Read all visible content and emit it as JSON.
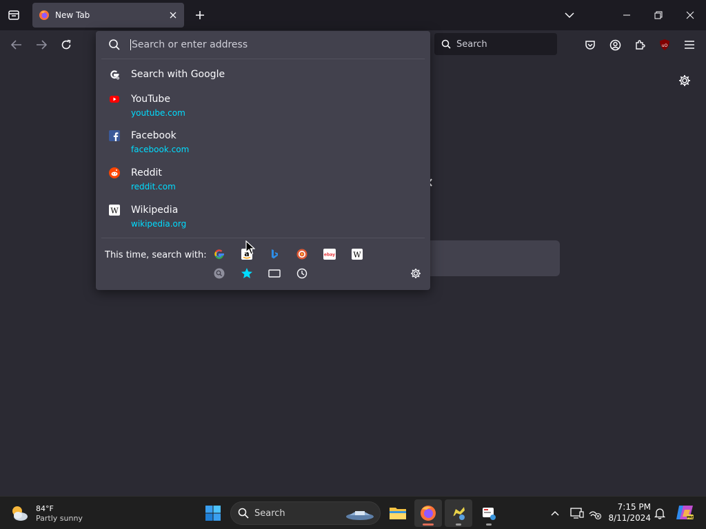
{
  "tab": {
    "title": "New Tab"
  },
  "toolbar": {
    "search_placeholder": "Search"
  },
  "urlbar": {
    "placeholder": "Search or enter address",
    "results": [
      {
        "title": "Search with Google",
        "icon": "google-icon"
      },
      {
        "title": "YouTube",
        "url": "youtube.com",
        "icon": "youtube-icon"
      },
      {
        "title": "Facebook",
        "url": "facebook.com",
        "icon": "facebook-icon"
      },
      {
        "title": "Reddit",
        "url": "reddit.com",
        "icon": "reddit-icon"
      },
      {
        "title": "Wikipedia",
        "url": "wikipedia.org",
        "icon": "wikipedia-icon"
      }
    ],
    "oneoff_label": "This time, search with:",
    "engines": [
      "google-icon",
      "amazon-icon",
      "bing-icon",
      "duckduckgo-icon",
      "ebay-icon",
      "wikipedia-icon"
    ],
    "local_sources": [
      "tabs-search-icon",
      "bookmarks-star-icon",
      "tabs-icon",
      "history-icon"
    ]
  },
  "ebay_text": "ebay",
  "taskbar": {
    "weather_temp": "84°F",
    "weather_desc": "Partly sunny",
    "search_label": "Search",
    "time": "7:15 PM",
    "date": "8/11/2024"
  },
  "colors": {
    "accent_url": "#00ddff",
    "panel_bg": "#42414d",
    "toolbar_bg": "#2b2a33",
    "frame_bg": "#1c1b22"
  }
}
